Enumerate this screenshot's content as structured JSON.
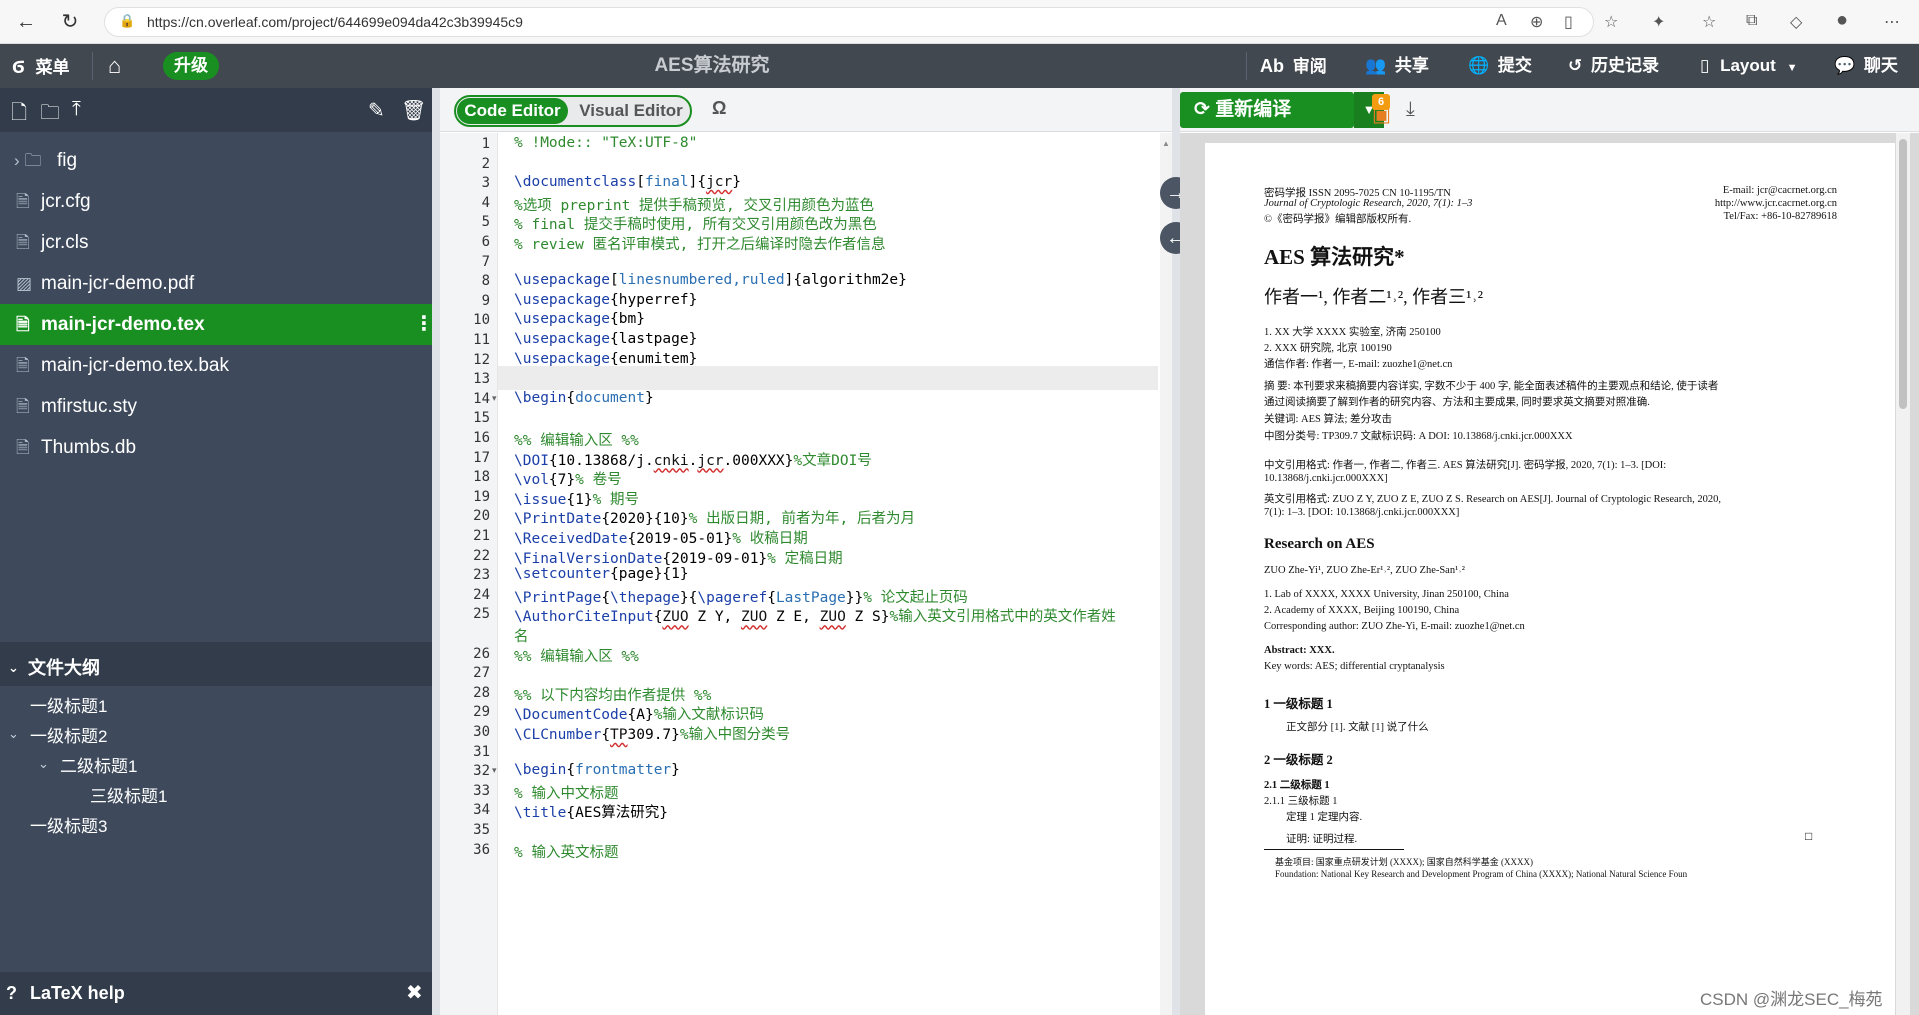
{
  "browser": {
    "url": "https://cn.overleaf.com/project/644699e094da42c3b39945c9"
  },
  "topbar": {
    "menu": "菜单",
    "upgrade": "升级",
    "title": "AES算法研究",
    "review": "审阅",
    "share": "共享",
    "submit": "提交",
    "history": "历史记录",
    "layout": "Layout",
    "chat": "聊天"
  },
  "files": [
    {
      "name": "fig",
      "type": "folder"
    },
    {
      "name": "jcr.cfg",
      "type": "file"
    },
    {
      "name": "jcr.cls",
      "type": "file"
    },
    {
      "name": "main-jcr-demo.pdf",
      "type": "image"
    },
    {
      "name": "main-jcr-demo.tex",
      "type": "file",
      "selected": true
    },
    {
      "name": "main-jcr-demo.tex.bak",
      "type": "file"
    },
    {
      "name": "mfirstuc.sty",
      "type": "file"
    },
    {
      "name": "Thumbs.db",
      "type": "file"
    }
  ],
  "outline": {
    "title": "文件大纲",
    "items": [
      {
        "label": "一级标题1",
        "level": 1
      },
      {
        "label": "一级标题2",
        "level": 1,
        "expanded": true
      },
      {
        "label": "二级标题1",
        "level": 2,
        "expanded": true
      },
      {
        "label": "三级标题1",
        "level": 3
      },
      {
        "label": "一级标题3",
        "level": 1
      }
    ]
  },
  "latex_help": "LaTeX help",
  "editor": {
    "code_tab": "Code Editor",
    "visual_tab": "Visual Editor",
    "omega": "Ω",
    "current_line": 13,
    "lines": [
      {
        "n": "1",
        "html": "<span class='c'>% !Mode:: \"TeX:UTF-8\"</span>"
      },
      {
        "n": "2",
        "html": ""
      },
      {
        "n": "3",
        "html": "<span class='k'>\\documentclass</span>[<span class='a'>final</span>]{<span class='e'>jcr</span>}"
      },
      {
        "n": "4",
        "html": "<span class='c'>%选项 preprint 提供手稿预览, 交叉引用颜色为蓝色</span>"
      },
      {
        "n": "5",
        "html": "<span class='c'>%    final    提交手稿时使用, 所有交叉引用颜色改为黑色</span>"
      },
      {
        "n": "6",
        "html": "<span class='c'>%    review   匿名评审模式, 打开之后编译时隐去作者信息</span>"
      },
      {
        "n": "7",
        "html": ""
      },
      {
        "n": "8",
        "html": "<span class='k'>\\usepackage</span>[<span class='a'>linesnumbered,ruled</span>]{algorithm2e}"
      },
      {
        "n": "9",
        "html": "<span class='k'>\\usepackage</span>{hyperref}"
      },
      {
        "n": "10",
        "html": "<span class='k'>\\usepackage</span>{bm}"
      },
      {
        "n": "11",
        "html": "<span class='k'>\\usepackage</span>{lastpage}"
      },
      {
        "n": "12",
        "html": "<span class='k'>\\usepackage</span>{enumitem}"
      },
      {
        "n": "13",
        "html": ""
      },
      {
        "n": "14",
        "html": "<span class='k'>\\begin</span>{<span class='a'>document</span>}",
        "fold": true
      },
      {
        "n": "15",
        "html": ""
      },
      {
        "n": "16",
        "html": "<span class='c'>%% 编辑输入区 %%</span>"
      },
      {
        "n": "17",
        "html": "<span class='k'>\\DOI</span>{10.13868/j.<span class='e'>cnki</span>.<span class='e'>jcr</span>.000XXX}<span class='c'>%文章DOI号</span>"
      },
      {
        "n": "18",
        "html": "<span class='k'>\\vol</span>{7}<span class='c'>% 卷号</span>"
      },
      {
        "n": "19",
        "html": "<span class='k'>\\issue</span>{1}<span class='c'>% 期号</span>"
      },
      {
        "n": "20",
        "html": "<span class='k'>\\PrintDate</span>{2020}{10}<span class='c'>% 出版日期, 前者为年, 后者为月</span>"
      },
      {
        "n": "21",
        "html": "<span class='k'>\\ReceivedDate</span>{2019-05-01}<span class='c'>% 收稿日期</span>"
      },
      {
        "n": "22",
        "html": "<span class='k'>\\FinalVersionDate</span>{2019-09-01}<span class='c'>% 定稿日期</span>"
      },
      {
        "n": "23",
        "html": "<span class='k'>\\setcounter</span>{page}{1}"
      },
      {
        "n": "24",
        "html": "<span class='k'>\\PrintPage</span>{<span class='k'>\\thepage</span>}{<span class='k'>\\pageref</span>{<span class='a'>LastPage</span>}}<span class='c'>% 论文起止页码</span>"
      },
      {
        "n": "25",
        "html": "<span class='k'>\\AuthorCiteInput</span>{<span class='e'>ZUO</span> Z Y, <span class='e'>ZUO</span> Z E, <span class='e'>ZUO</span> Z S}<span class='c'>%输入英文引用格式中的英文作者姓</span>",
        "wrap": "<span class='c'>名</span>"
      },
      {
        "n": "26",
        "html": "<span class='c'>%% 编辑输入区 %%</span>"
      },
      {
        "n": "27",
        "html": ""
      },
      {
        "n": "28",
        "html": "<span class='c'>%% 以下内容均由作者提供 %%</span>"
      },
      {
        "n": "29",
        "html": "<span class='k'>\\DocumentCode</span>{A}<span class='c'>%输入文献标识码</span>"
      },
      {
        "n": "30",
        "html": "<span class='k'>\\CLCnumber</span>{<span class='e'>TP</span>309.7}<span class='c'>%输入中图分类号</span>"
      },
      {
        "n": "31",
        "html": ""
      },
      {
        "n": "32",
        "html": "<span class='k'>\\begin</span>{<span class='a'>frontmatter</span>}",
        "fold": true
      },
      {
        "n": "33",
        "html": "  <span class='c'>% 输入中文标题</span>"
      },
      {
        "n": "34",
        "html": "  <span class='k'>\\title</span>{AES算法研究}"
      },
      {
        "n": "35",
        "html": ""
      },
      {
        "n": "36",
        "html": "  <span class='c'>% 输入英文标题</span>"
      }
    ]
  },
  "pdf_toolbar": {
    "recompile": "重新编译",
    "log_count": "6"
  },
  "pdf": {
    "hdr_l1": "密码学报   ISSN 2095-7025   CN 10-1195/TN",
    "hdr_l2": "Journal of Cryptologic Research, 2020, 7(1): 1–3",
    "hdr_l3": "©《密码学报》编辑部版权所有.",
    "hdr_r1": "E-mail: jcr@cacrnet.org.cn",
    "hdr_r2": "http://www.jcr.cacrnet.org.cn",
    "hdr_r3": "Tel/Fax: +86-10-82789618",
    "title": "AES 算法研究*",
    "authors": "作者一¹,  作者二¹˒²,  作者三¹˒²",
    "aff1": "1. XX 大学 XXXX 实验室, 济南 250100",
    "aff2": "2. XXX 研究院, 北京 100190",
    "corr": "通信作者: 作者一, E-mail: zuozhe1@net.cn",
    "abs1": "摘   要:  本刊要求来稿摘要内容详实, 字数不少于 400 字, 能全面表述稿件的主要观点和结论, 使于读者",
    "abs2": "通过阅读摘要了解到作者的研究内容、方法和主要成果, 同时要求英文摘要对照准确.",
    "keywords": "关键词:   AES 算法; 差分攻击",
    "clc": "中图分类号: TP309.7        文献标识码: A        DOI: 10.13868/j.cnki.jcr.000XXX",
    "cite_cn1": "中文引用格式:   作者一, 作者二, 作者三.    AES 算法研究[J].  密码学报,  2020,  7(1):   1–3.    [DOI:",
    "cite_cn2": "10.13868/j.cnki.jcr.000XXX]",
    "cite_en1": "英文引用格式: ZUO Z Y, ZUO Z E, ZUO Z S. Research on AES[J]. Journal of Cryptologic Research, 2020,",
    "cite_en2": "7(1): 1–3. [DOI: 10.13868/j.cnki.jcr.000XXX]",
    "en_title": "Research on AES",
    "en_authors": "ZUO Zhe-Yi¹,   ZUO Zhe-Er¹˒²,   ZUO Zhe-San¹˒²",
    "en_aff1": "1. Lab of XXXX, XXXX University, Jinan 250100, China",
    "en_aff2": "2. Academy of XXXX, Beijing 100190, China",
    "en_corr": "Corresponding author: ZUO Zhe-Yi, E-mail: zuozhe1@net.cn",
    "en_abs": "Abstract:   XXX.",
    "en_kw": "Key words:   AES; differential cryptanalysis",
    "s1": "1    一级标题 1",
    "s1_body": "正文部分 [1]. 文献 [1] 说了什么",
    "s2": "2    一级标题 2",
    "s21": "2.1    二级标题 1",
    "s211": "2.1.1    三级标题 1",
    "thm": "定理 1  定理内容.",
    "proof": "证明:    证明过程.",
    "fn1": "基金项目: 国家重点研发计划 (XXXX); 国家自然科学基金 (XXXX)",
    "fn2": "Foundation: National Key Research and Development Program of China (XXXX); National Natural Science Foun"
  },
  "watermark": "CSDN @渊龙SEC_梅苑"
}
